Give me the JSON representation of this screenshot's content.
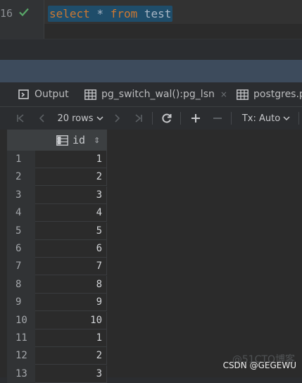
{
  "editor": {
    "line_number": "16",
    "code": {
      "kw1": "select",
      "star": " * ",
      "kw2": "from",
      "table": " test"
    }
  },
  "tabs": [
    {
      "label": "Output",
      "icon": "output-icon"
    },
    {
      "label": "pg_switch_wal():pg_lsn",
      "icon": "table-icon",
      "close": "×"
    },
    {
      "label": "postgres.pu",
      "icon": "table-icon"
    }
  ],
  "toolbar": {
    "rows_label": "20 rows",
    "tx_label": "Tx: Auto"
  },
  "grid": {
    "column_header": "id",
    "sort_glyph": "⇕",
    "rows": [
      {
        "num": "1",
        "id": "1"
      },
      {
        "num": "2",
        "id": "2"
      },
      {
        "num": "3",
        "id": "3"
      },
      {
        "num": "4",
        "id": "4"
      },
      {
        "num": "5",
        "id": "5"
      },
      {
        "num": "6",
        "id": "6"
      },
      {
        "num": "7",
        "id": "7"
      },
      {
        "num": "8",
        "id": "8"
      },
      {
        "num": "9",
        "id": "9"
      },
      {
        "num": "10",
        "id": "10"
      },
      {
        "num": "11",
        "id": "1"
      },
      {
        "num": "12",
        "id": "2"
      },
      {
        "num": "13",
        "id": "3"
      }
    ]
  },
  "watermark": "CSDN @GEGEWU",
  "watermark_faint": "@51CTO博客"
}
